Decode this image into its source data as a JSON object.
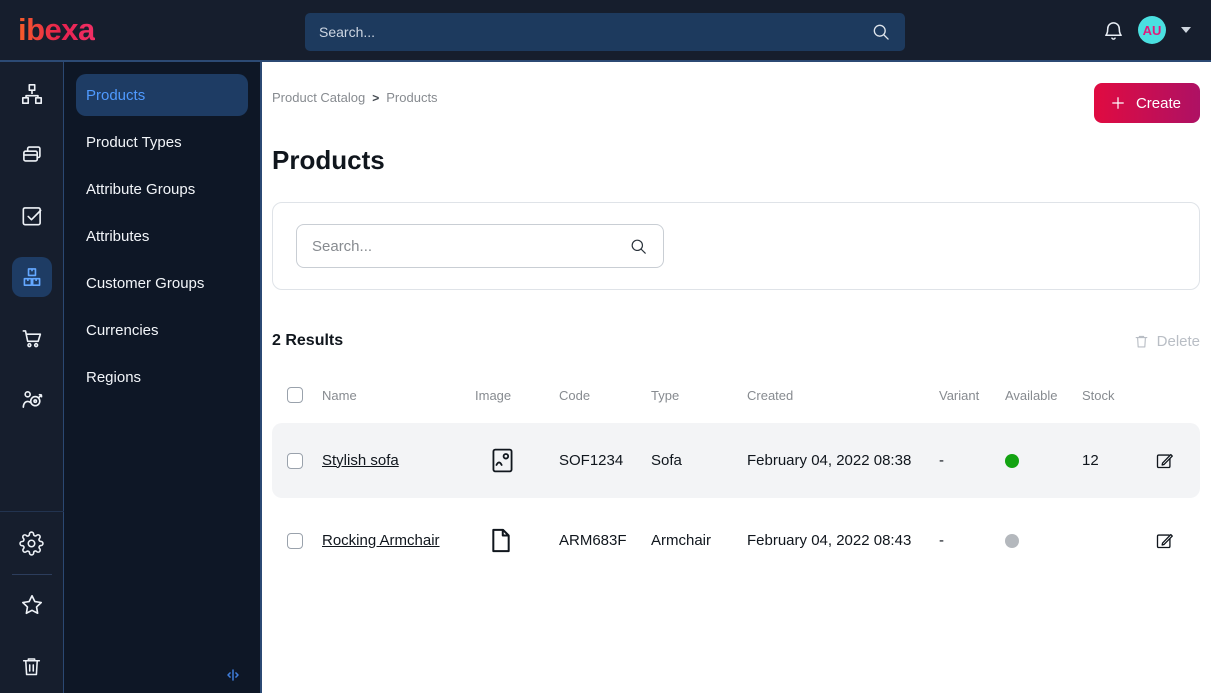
{
  "topbar": {
    "logo_text": "ibexa",
    "search_placeholder": "Search...",
    "avatar_initials": "AU"
  },
  "rail": {
    "items": [
      "sitemap-icon",
      "pages-icon",
      "checklist-icon",
      "product-catalog-icon",
      "cart-icon",
      "personalization-icon"
    ],
    "active_item": "product-catalog-icon",
    "footer_items": [
      "gear-icon",
      "star-icon",
      "trash-icon"
    ]
  },
  "sidebar": {
    "items": [
      {
        "label": "Products",
        "active": true
      },
      {
        "label": "Product Types",
        "active": false
      },
      {
        "label": "Attribute Groups",
        "active": false
      },
      {
        "label": "Attributes",
        "active": false
      },
      {
        "label": "Customer Groups",
        "active": false
      },
      {
        "label": "Currencies",
        "active": false
      },
      {
        "label": "Regions",
        "active": false
      }
    ]
  },
  "main": {
    "breadcrumb": {
      "parent": "Product Catalog",
      "current": "Products"
    },
    "create_label": "Create",
    "title": "Products",
    "filter_search_placeholder": "Search...",
    "results_label": "2 Results",
    "delete_label": "Delete",
    "table": {
      "columns": {
        "name": "Name",
        "image": "Image",
        "code": "Code",
        "type": "Type",
        "created": "Created",
        "variant": "Variant",
        "available": "Available",
        "stock": "Stock"
      },
      "rows": [
        {
          "name": "Stylish sofa",
          "image_icon": "image-icon",
          "code": "SOF1234",
          "type": "Sofa",
          "created": "February 04, 2022 08:38",
          "variant": "-",
          "available": true,
          "stock": "12"
        },
        {
          "name": "Rocking Armchair",
          "image_icon": "file-icon",
          "code": "ARM683F",
          "type": "Armchair",
          "created": "February 04, 2022 08:43",
          "variant": "-",
          "available": false,
          "stock": ""
        }
      ]
    }
  },
  "colors": {
    "brand_gradient_start": "#db0032",
    "brand_gradient_end": "#ae1164",
    "active_item_bg": "#1e3c64",
    "active_item_text": "#4f9aff",
    "available_green": "#13a312",
    "unavailable_gray": "#b4b8bd",
    "avatar_bg": "#4ae0e0",
    "avatar_text": "#e01c7c",
    "topbar_bg": "#161e2d",
    "sidebar_bg": "#0e1726"
  }
}
